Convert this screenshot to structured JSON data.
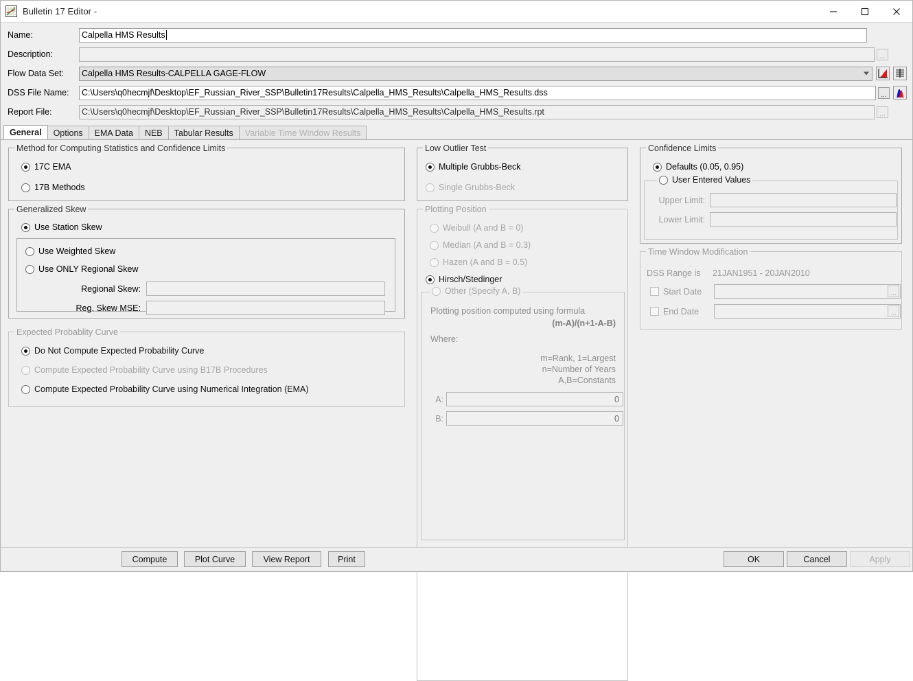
{
  "window": {
    "title": "Bulletin 17 Editor -",
    "icon": "line-chart-icon",
    "minimize_label": "—",
    "maximize_label": "☐",
    "close_label": "✕"
  },
  "fields": {
    "name": {
      "label": "Name:",
      "value": "Calpella HMS Results"
    },
    "description": {
      "label": "Description:",
      "value": "",
      "browse_label": "..."
    },
    "flow_data_set": {
      "label": "Flow Data Set:",
      "value": "Calpella HMS Results-CALPELLA GAGE-FLOW"
    },
    "dss_file_name": {
      "label": "DSS File Name:",
      "value": "C:\\Users\\q0hecmjf\\Desktop\\EF_Russian_River_SSP\\Bulletin17Results\\Calpella_HMS_Results\\Calpella_HMS_Results.dss",
      "browse_label": "..."
    },
    "report_file": {
      "label": "Report File:",
      "value": "C:\\Users\\q0hecmjf\\Desktop\\EF_Russian_River_SSP\\Bulletin17Results\\Calpella_HMS_Results\\Calpella_HMS_Results.rpt",
      "browse_label": "..."
    },
    "side_icons": [
      {
        "name": "plot-curve-icon"
      },
      {
        "name": "table-results-icon"
      },
      {
        "name": "histogram-icon"
      }
    ]
  },
  "tabs": [
    {
      "label": "General",
      "active": true,
      "disabled": false
    },
    {
      "label": "Options",
      "active": false,
      "disabled": false
    },
    {
      "label": "EMA Data",
      "active": false,
      "disabled": false
    },
    {
      "label": "NEB",
      "active": false,
      "disabled": false
    },
    {
      "label": "Tabular Results",
      "active": false,
      "disabled": false
    },
    {
      "label": "Variable Time Window Results",
      "active": false,
      "disabled": true
    }
  ],
  "method_group": {
    "label": "Method for Computing Statistics and Confidence Limits",
    "options": [
      {
        "label": "17C EMA",
        "selected": true,
        "disabled": false
      },
      {
        "label": "17B Methods",
        "selected": false,
        "disabled": false
      }
    ]
  },
  "generalized_skew": {
    "label": "Generalized Skew",
    "use_station_skew": {
      "label": "Use Station Skew",
      "selected": true
    },
    "inner": {
      "use_weighted_skew": {
        "label": "Use Weighted Skew",
        "selected": false
      },
      "use_only_regional_skew": {
        "label": "Use ONLY Regional Skew",
        "selected": false
      },
      "regional_skew": {
        "label": "Regional Skew:",
        "value": ""
      },
      "reg_skew_mse": {
        "label": "Reg. Skew MSE:",
        "value": ""
      }
    }
  },
  "expected_probability": {
    "label": "Expected Probablity Curve",
    "options": [
      {
        "label": "Do Not Compute Expected Probability Curve",
        "selected": true,
        "disabled": false
      },
      {
        "label": "Compute Expected Probability Curve using B17B Procedures",
        "selected": false,
        "disabled": true
      },
      {
        "label": "Compute Expected Probability Curve using Numerical Integration (EMA)",
        "selected": false,
        "disabled": false
      }
    ]
  },
  "low_outlier_test": {
    "label": "Low Outlier Test",
    "options": [
      {
        "label": "Multiple Grubbs-Beck",
        "selected": true,
        "disabled": false
      },
      {
        "label": "Single Grubbs-Beck",
        "selected": false,
        "disabled": true
      }
    ]
  },
  "plotting_position": {
    "label": "Plotting Position",
    "options": [
      {
        "label": "Weibull (A and B = 0)",
        "selected": false,
        "disabled": true
      },
      {
        "label": "Median (A and B = 0.3)",
        "selected": false,
        "disabled": true
      },
      {
        "label": "Hazen (A and B = 0.5)",
        "selected": false,
        "disabled": true
      },
      {
        "label": "Hirsch/Stedinger",
        "selected": true,
        "disabled": false
      }
    ],
    "other": {
      "label": "Other (Specify A, B)",
      "selected": false,
      "disabled": true,
      "formula_intro": "Plotting position computed using formula",
      "formula": "(m-A)/(n+1-A-B)",
      "where_label": "Where:",
      "where_lines": [
        "m=Rank, 1=Largest",
        "n=Number of Years",
        "A,B=Constants"
      ],
      "a_field": {
        "label": "A:",
        "value": "0"
      },
      "b_field": {
        "label": "B:",
        "value": "0"
      }
    }
  },
  "confidence_limits": {
    "label": "Confidence Limits",
    "defaults": {
      "label": "Defaults (0.05, 0.95)",
      "selected": true
    },
    "user_entered": {
      "label": "User Entered Values",
      "selected": false,
      "upper_limit": {
        "label": "Upper Limit:",
        "value": ""
      },
      "lower_limit": {
        "label": "Lower Limit:",
        "value": ""
      }
    }
  },
  "time_window": {
    "label": "Time Window Modification",
    "dss_range_label": "DSS Range is",
    "dss_range_value": "21JAN1951 - 20JAN2010",
    "start_date": {
      "label": "Start Date",
      "checked": false,
      "value": "",
      "browse_label": "..."
    },
    "end_date": {
      "label": "End Date",
      "checked": false,
      "value": "",
      "browse_label": "..."
    }
  },
  "buttons": {
    "compute": "Compute",
    "plot_curve": "Plot Curve",
    "view_report": "View Report",
    "print": "Print",
    "ok": "OK",
    "cancel": "Cancel",
    "apply": "Apply"
  },
  "colors": {
    "window_bg": "#efefef",
    "field_bg": "#ffffff",
    "readonly_bg": "#e0e0e0",
    "disabled_text": "#a6a6a6",
    "chart_red": "#cc1111",
    "chart_blue": "#1111cc",
    "chart_green": "#119911"
  }
}
